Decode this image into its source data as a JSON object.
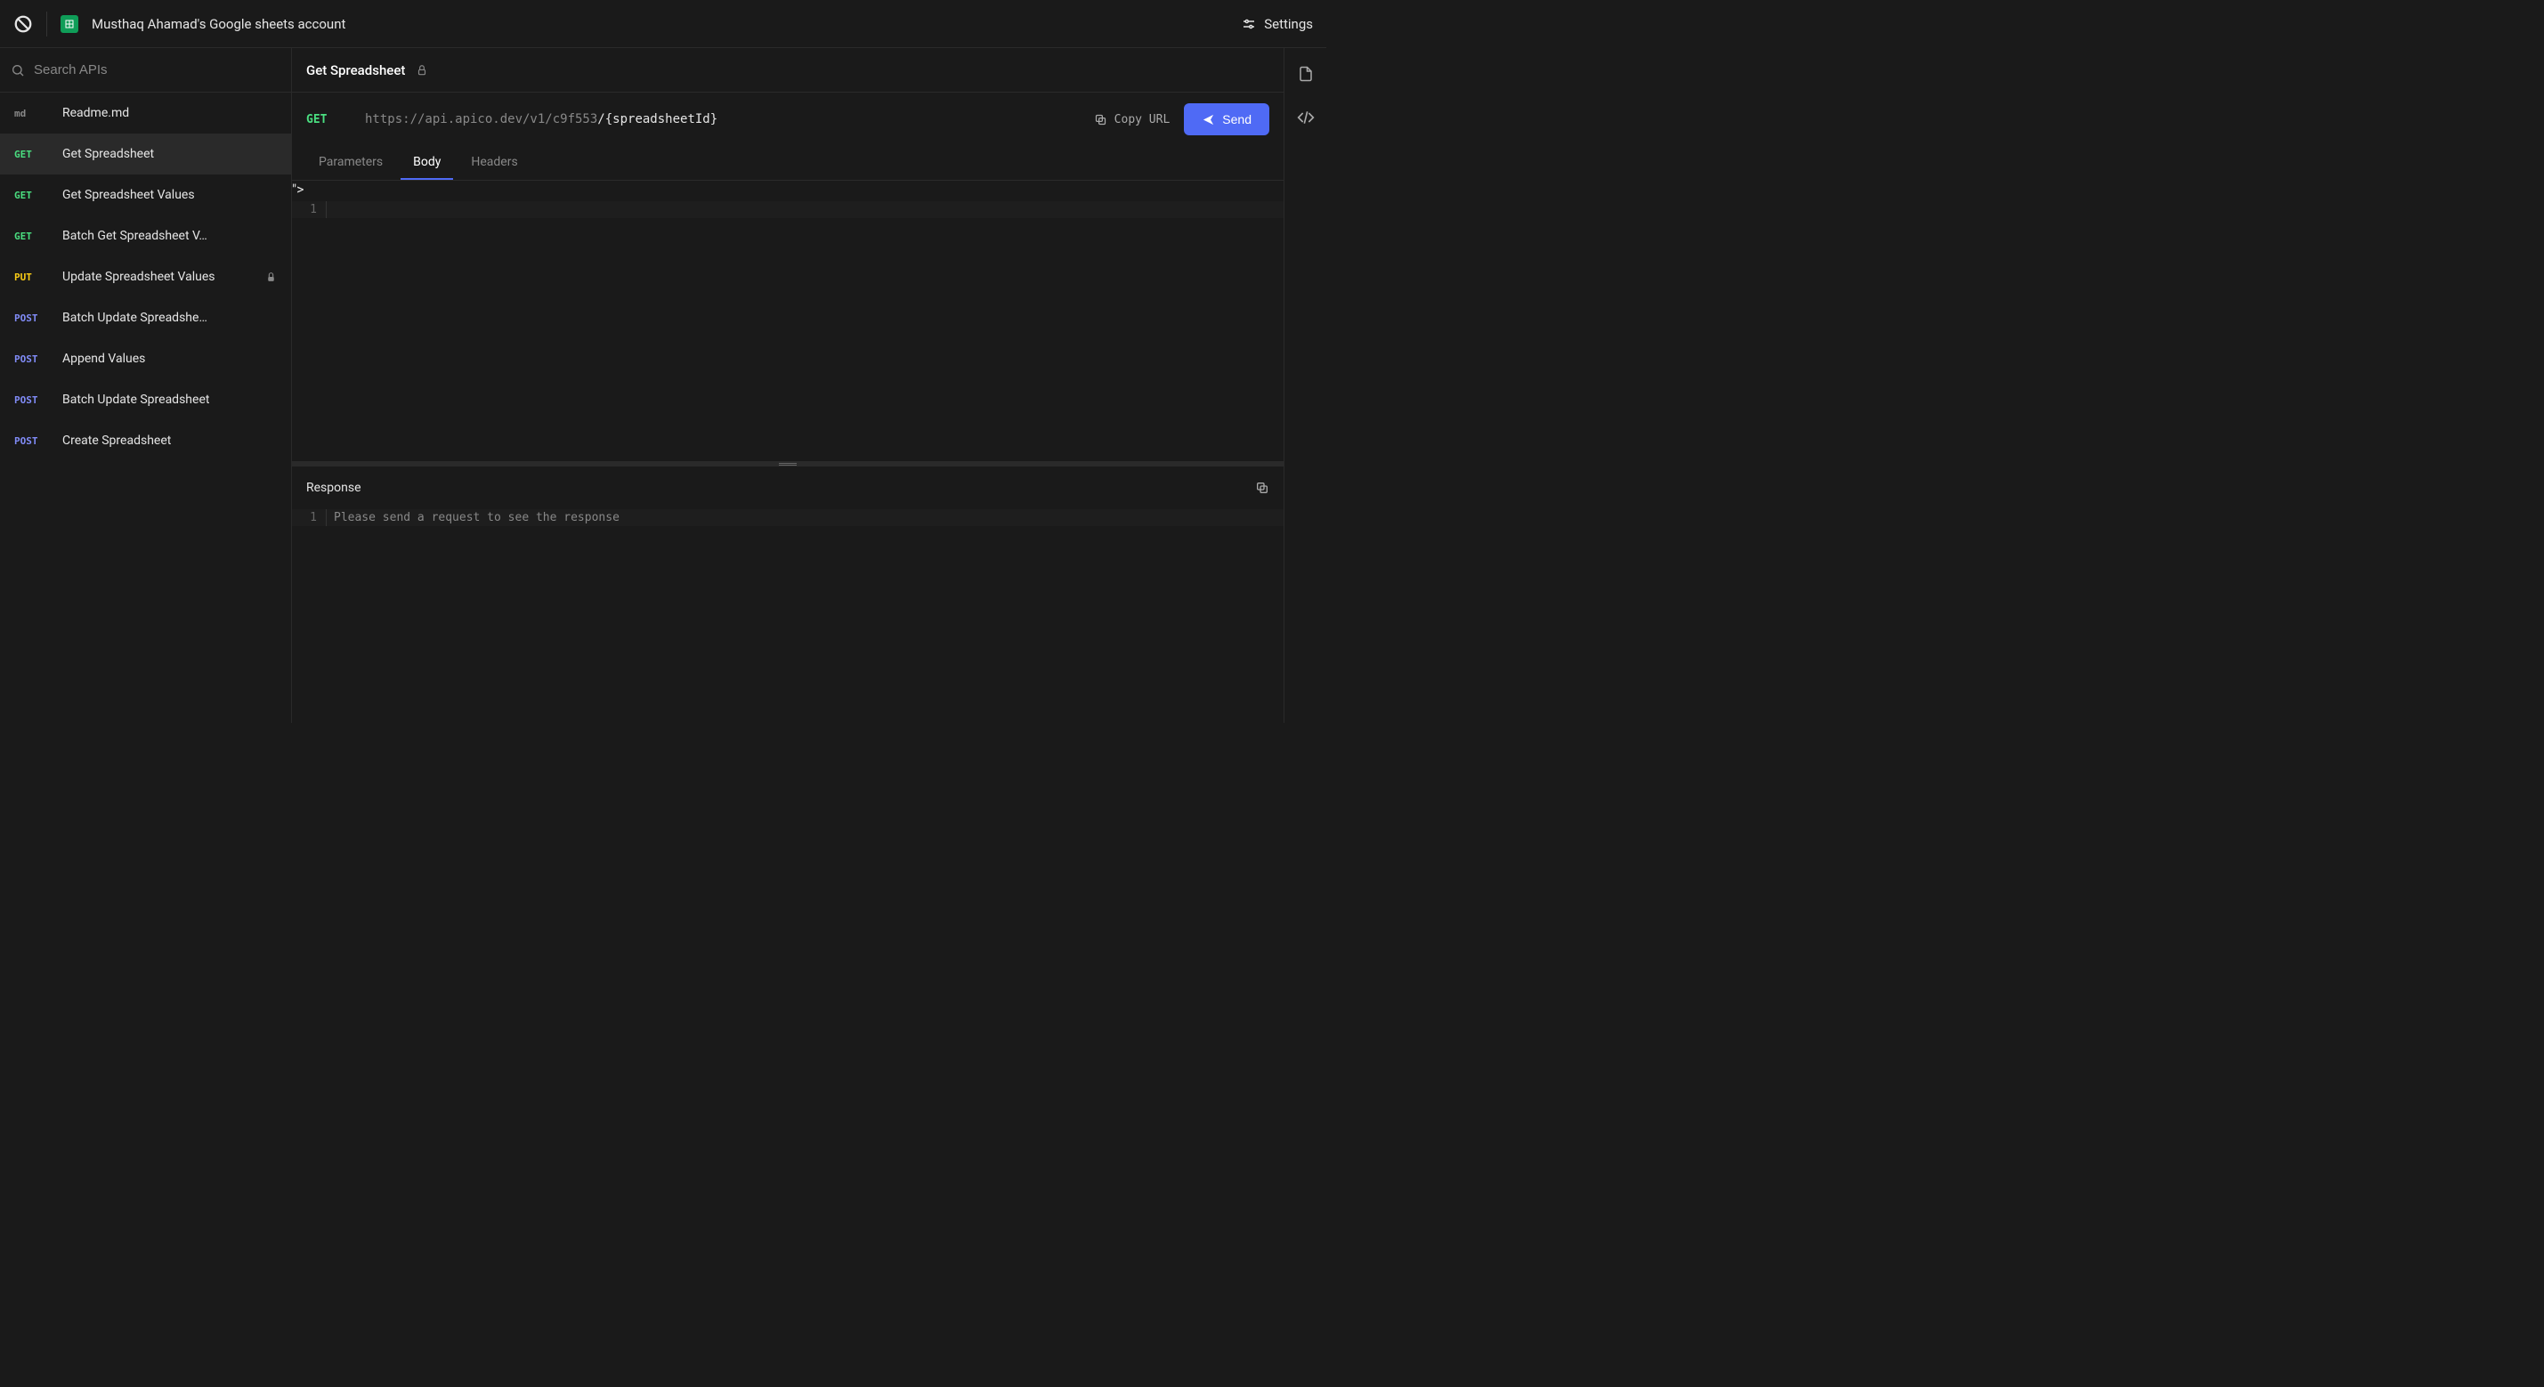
{
  "header": {
    "account_name": "Musthaq Ahamad's Google sheets account",
    "settings_label": "Settings"
  },
  "sidebar": {
    "search_placeholder": "Search APIs",
    "items": [
      {
        "method": "md",
        "label": "Readme.md",
        "active": false,
        "locked": false
      },
      {
        "method": "GET",
        "label": "Get Spreadsheet",
        "active": true,
        "locked": false
      },
      {
        "method": "GET",
        "label": "Get Spreadsheet Values",
        "active": false,
        "locked": false
      },
      {
        "method": "GET",
        "label": "Batch Get Spreadsheet V…",
        "active": false,
        "locked": false
      },
      {
        "method": "PUT",
        "label": "Update Spreadsheet Values",
        "active": false,
        "locked": true
      },
      {
        "method": "POST",
        "label": "Batch Update Spreadshe…",
        "active": false,
        "locked": false
      },
      {
        "method": "POST",
        "label": "Append Values",
        "active": false,
        "locked": false
      },
      {
        "method": "POST",
        "label": "Batch Update Spreadsheet",
        "active": false,
        "locked": false
      },
      {
        "method": "POST",
        "label": "Create Spreadsheet",
        "active": false,
        "locked": false
      }
    ]
  },
  "main": {
    "title": "Get Spreadsheet",
    "locked": true,
    "request": {
      "method": "GET",
      "url_base": "https://api.apico.dev/v1/c9f553",
      "url_path": "/{spreadsheetId}",
      "copy_url_label": "Copy URL",
      "send_label": "Send",
      "tabs": [
        {
          "label": "Parameters",
          "active": false
        },
        {
          "label": "Body",
          "active": true
        },
        {
          "label": "Headers",
          "active": false
        }
      ],
      "body_line_number": "1",
      "body_content": ""
    },
    "response": {
      "header_label": "Response",
      "line_number": "1",
      "placeholder": "Please send a request to see the response"
    }
  }
}
